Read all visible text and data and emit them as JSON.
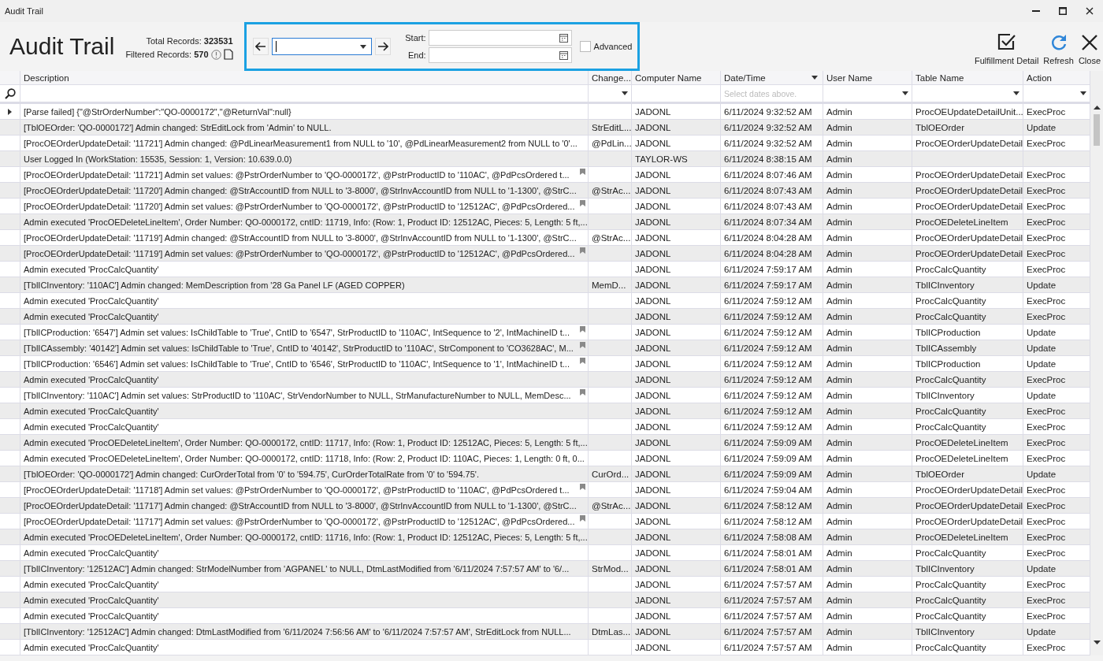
{
  "window": {
    "title": "Audit Trail"
  },
  "header": {
    "title": "Audit Trail",
    "total_label": "Total Records:",
    "total": "323531",
    "filtered_label": "Filtered Records:",
    "filtered": "570"
  },
  "filter": {
    "start_label": "Start:",
    "end_label": "End:",
    "advanced": {
      "label": "Advanced",
      "checked": false
    }
  },
  "toolbar": [
    {
      "label": "Fulfillment Detail",
      "kind": "check"
    },
    {
      "label": "Refresh",
      "kind": "refresh"
    },
    {
      "label": "Close",
      "kind": "close"
    }
  ],
  "table": {
    "columns": [
      {
        "label": "Description",
        "dropdown": false
      },
      {
        "label": "Change...",
        "dropdown": false
      },
      {
        "label": "Computer Name",
        "dropdown": false
      },
      {
        "label": "Date/Time",
        "dropdown": true
      },
      {
        "label": "User Name",
        "dropdown": false
      },
      {
        "label": "Table Name",
        "dropdown": false
      },
      {
        "label": "Action",
        "dropdown": false
      }
    ],
    "filter_row": [
      {
        "kind": "text"
      },
      {
        "kind": "dropdown"
      },
      {
        "kind": "text"
      },
      {
        "kind": "date",
        "placeholder": "Select dates above."
      },
      {
        "kind": "dropdown"
      },
      {
        "kind": "dropdown"
      },
      {
        "kind": "dropdown"
      }
    ],
    "rows": [
      {
        "current": true,
        "note": false,
        "cells": [
          "[Parse failed] {\"@StrOrderNumber\":\"QO-0000172\",\"@ReturnVal\":null}",
          "",
          "JADONL",
          "6/11/2024 9:32:52 AM",
          "Admin",
          "ProcOEUpdateDetailUnit...",
          "ExecProc"
        ]
      },
      {
        "current": false,
        "note": false,
        "cells": [
          "[TblOEOrder: 'QO-0000172'] Admin changed: StrEditLock from 'Admin' to NULL.",
          "StrEditL...",
          "JADONL",
          "6/11/2024 9:32:52 AM",
          "Admin",
          "TblOEOrder",
          "Update"
        ]
      },
      {
        "current": false,
        "note": false,
        "cells": [
          "[ProcOEOrderUpdateDetail: '11721'] Admin changed: @PdLinearMeasurement1 from NULL to '10', @PdLinearMeasurement2 from NULL to '0'...",
          "@PdLin...",
          "JADONL",
          "6/11/2024 9:32:52 AM",
          "Admin",
          "ProcOEOrderUpdateDetail",
          "ExecProc"
        ]
      },
      {
        "current": false,
        "note": false,
        "cells": [
          "User Logged In (WorkStation: 15535, Session: 1, Version: 10.639.0.0)",
          "",
          "TAYLOR-WS",
          "6/11/2024 8:38:15 AM",
          "Admin",
          "",
          ""
        ]
      },
      {
        "current": false,
        "note": true,
        "cells": [
          "[ProcOEOrderUpdateDetail: '11721'] Admin set values: @PstrOrderNumber to 'QO-0000172', @PstrProductID to '110AC', @PdPcsOrdered t...",
          "",
          "JADONL",
          "6/11/2024 8:07:46 AM",
          "Admin",
          "ProcOEOrderUpdateDetail",
          "ExecProc"
        ]
      },
      {
        "current": false,
        "note": false,
        "cells": [
          "[ProcOEOrderUpdateDetail: '11720'] Admin changed: @StrAccountID from NULL to '3-8000', @StrInvAccountID from NULL to '1-1300', @StrC...",
          "@StrAc...",
          "JADONL",
          "6/11/2024 8:07:43 AM",
          "Admin",
          "ProcOEOrderUpdateDetail",
          "ExecProc"
        ]
      },
      {
        "current": false,
        "note": true,
        "cells": [
          "[ProcOEOrderUpdateDetail: '11720'] Admin set values: @PstrOrderNumber to 'QO-0000172', @PstrProductID to '12512AC', @PdPcsOrdered...",
          "",
          "JADONL",
          "6/11/2024 8:07:43 AM",
          "Admin",
          "ProcOEOrderUpdateDetail",
          "ExecProc"
        ]
      },
      {
        "current": false,
        "note": false,
        "cells": [
          "Admin executed 'ProcOEDeleteLineItem', Order Number: QO-0000172, cntID: 11719, Info: (Row: 1, Product ID: 12512AC, Pieces: 5, Length: 5 ft,...",
          "",
          "JADONL",
          "6/11/2024 8:07:34 AM",
          "Admin",
          "ProcOEDeleteLineItem",
          "ExecProc"
        ]
      },
      {
        "current": false,
        "note": false,
        "cells": [
          "[ProcOEOrderUpdateDetail: '11719'] Admin changed: @StrAccountID from NULL to '3-8000', @StrInvAccountID from NULL to '1-1300', @StrC...",
          "@StrAc...",
          "JADONL",
          "6/11/2024 8:04:28 AM",
          "Admin",
          "ProcOEOrderUpdateDetail",
          "ExecProc"
        ]
      },
      {
        "current": false,
        "note": true,
        "cells": [
          "[ProcOEOrderUpdateDetail: '11719'] Admin set values: @PstrOrderNumber to 'QO-0000172', @PstrProductID to '12512AC', @PdPcsOrdered...",
          "",
          "JADONL",
          "6/11/2024 8:04:28 AM",
          "Admin",
          "ProcOEOrderUpdateDetail",
          "ExecProc"
        ]
      },
      {
        "current": false,
        "note": false,
        "cells": [
          "Admin executed 'ProcCalcQuantity'",
          "",
          "JADONL",
          "6/11/2024 7:59:17 AM",
          "Admin",
          "ProcCalcQuantity",
          "ExecProc"
        ]
      },
      {
        "current": false,
        "note": false,
        "cells": [
          "[TblICInventory: '110AC'] Admin changed: MemDescription from '28 Ga Panel LF (AGED COPPER)",
          "MemD...",
          "JADONL",
          "6/11/2024 7:59:17 AM",
          "Admin",
          "TblICInventory",
          "Update"
        ]
      },
      {
        "current": false,
        "note": false,
        "cells": [
          "Admin executed 'ProcCalcQuantity'",
          "",
          "JADONL",
          "6/11/2024 7:59:12 AM",
          "Admin",
          "ProcCalcQuantity",
          "ExecProc"
        ]
      },
      {
        "current": false,
        "note": false,
        "cells": [
          "Admin executed 'ProcCalcQuantity'",
          "",
          "JADONL",
          "6/11/2024 7:59:12 AM",
          "Admin",
          "ProcCalcQuantity",
          "ExecProc"
        ]
      },
      {
        "current": false,
        "note": true,
        "cells": [
          "[TblICProduction: '6547'] Admin set values: IsChildTable to 'True', CntID to '6547', StrProductID to '110AC', IntSequence to '2', IntMachineID t...",
          "",
          "JADONL",
          "6/11/2024 7:59:12 AM",
          "Admin",
          "TblICProduction",
          "Update"
        ]
      },
      {
        "current": false,
        "note": true,
        "cells": [
          "[TblICAssembly: '40142'] Admin set values: IsChildTable to 'True', CntID to '40142', StrProductID to '110AC', StrComponent to 'CO3628AC', M...",
          "",
          "JADONL",
          "6/11/2024 7:59:12 AM",
          "Admin",
          "TblICAssembly",
          "Update"
        ]
      },
      {
        "current": false,
        "note": true,
        "cells": [
          "[TblICProduction: '6546'] Admin set values: IsChildTable to 'True', CntID to '6546', StrProductID to '110AC', IntSequence to '1', IntMachineID t...",
          "",
          "JADONL",
          "6/11/2024 7:59:12 AM",
          "Admin",
          "TblICProduction",
          "Update"
        ]
      },
      {
        "current": false,
        "note": false,
        "cells": [
          "Admin executed 'ProcCalcQuantity'",
          "",
          "JADONL",
          "6/11/2024 7:59:12 AM",
          "Admin",
          "ProcCalcQuantity",
          "ExecProc"
        ]
      },
      {
        "current": false,
        "note": true,
        "cells": [
          "[TblICInventory: '110AC'] Admin set values: StrProductID to '110AC', StrVendorNumber to NULL, StrManufactureNumber to NULL, MemDesc...",
          "",
          "JADONL",
          "6/11/2024 7:59:12 AM",
          "Admin",
          "TblICInventory",
          "Update"
        ]
      },
      {
        "current": false,
        "note": false,
        "cells": [
          "Admin executed 'ProcCalcQuantity'",
          "",
          "JADONL",
          "6/11/2024 7:59:12 AM",
          "Admin",
          "ProcCalcQuantity",
          "ExecProc"
        ]
      },
      {
        "current": false,
        "note": false,
        "cells": [
          "Admin executed 'ProcCalcQuantity'",
          "",
          "JADONL",
          "6/11/2024 7:59:12 AM",
          "Admin",
          "ProcCalcQuantity",
          "ExecProc"
        ]
      },
      {
        "current": false,
        "note": false,
        "cells": [
          "Admin executed 'ProcOEDeleteLineItem', Order Number: QO-0000172, cntID: 11717, Info: (Row: 1, Product ID: 12512AC, Pieces: 5, Length: 5 ft,...",
          "",
          "JADONL",
          "6/11/2024 7:59:09 AM",
          "Admin",
          "ProcOEDeleteLineItem",
          "ExecProc"
        ]
      },
      {
        "current": false,
        "note": false,
        "cells": [
          "Admin executed 'ProcOEDeleteLineItem', Order Number: QO-0000172, cntID: 11718, Info: (Row: 2, Product ID: 110AC, Pieces: 1, Length: 0 ft, 0...",
          "",
          "JADONL",
          "6/11/2024 7:59:09 AM",
          "Admin",
          "ProcOEDeleteLineItem",
          "ExecProc"
        ]
      },
      {
        "current": false,
        "note": false,
        "cells": [
          "[TblOEOrder: 'QO-0000172'] Admin changed: CurOrderTotal from '0' to '594.75', CurOrderTotalRate from '0' to '594.75'.",
          "CurOrd...",
          "JADONL",
          "6/11/2024 7:59:09 AM",
          "Admin",
          "TblOEOrder",
          "Update"
        ]
      },
      {
        "current": false,
        "note": true,
        "cells": [
          "[ProcOEOrderUpdateDetail: '11718'] Admin set values: @PstrOrderNumber to 'QO-0000172', @PstrProductID to '110AC', @PdPcsOrdered t...",
          "",
          "JADONL",
          "6/11/2024 7:59:04 AM",
          "Admin",
          "ProcOEOrderUpdateDetail",
          "ExecProc"
        ]
      },
      {
        "current": false,
        "note": false,
        "cells": [
          "[ProcOEOrderUpdateDetail: '11717'] Admin changed: @StrAccountID from NULL to '3-8000', @StrInvAccountID from NULL to '1-1300', @StrC...",
          "@StrAc...",
          "JADONL",
          "6/11/2024 7:58:12 AM",
          "Admin",
          "ProcOEOrderUpdateDetail",
          "ExecProc"
        ]
      },
      {
        "current": false,
        "note": true,
        "cells": [
          "[ProcOEOrderUpdateDetail: '11717'] Admin set values: @PstrOrderNumber to 'QO-0000172', @PstrProductID to '12512AC', @PdPcsOrdered...",
          "",
          "JADONL",
          "6/11/2024 7:58:12 AM",
          "Admin",
          "ProcOEOrderUpdateDetail",
          "ExecProc"
        ]
      },
      {
        "current": false,
        "note": false,
        "cells": [
          "Admin executed 'ProcOEDeleteLineItem', Order Number: QO-0000172, cntID: 11716, Info: (Row: 1, Product ID: 12512AC, Pieces: 5, Length: 5 ft,...",
          "",
          "JADONL",
          "6/11/2024 7:58:08 AM",
          "Admin",
          "ProcOEDeleteLineItem",
          "ExecProc"
        ]
      },
      {
        "current": false,
        "note": false,
        "cells": [
          "Admin executed 'ProcCalcQuantity'",
          "",
          "JADONL",
          "6/11/2024 7:58:01 AM",
          "Admin",
          "ProcCalcQuantity",
          "ExecProc"
        ]
      },
      {
        "current": false,
        "note": false,
        "cells": [
          "[TblICInventory: '12512AC'] Admin changed: StrModelNumber from 'AGPANEL' to NULL, DtmLastModified from '6/11/2024 7:57:57 AM' to '6/...",
          "StrMod...",
          "JADONL",
          "6/11/2024 7:58:01 AM",
          "Admin",
          "TblICInventory",
          "Update"
        ]
      },
      {
        "current": false,
        "note": false,
        "cells": [
          "Admin executed 'ProcCalcQuantity'",
          "",
          "JADONL",
          "6/11/2024 7:57:57 AM",
          "Admin",
          "ProcCalcQuantity",
          "ExecProc"
        ]
      },
      {
        "current": false,
        "note": false,
        "cells": [
          "Admin executed 'ProcCalcQuantity'",
          "",
          "JADONL",
          "6/11/2024 7:57:57 AM",
          "Admin",
          "ProcCalcQuantity",
          "ExecProc"
        ]
      },
      {
        "current": false,
        "note": false,
        "cells": [
          "Admin executed 'ProcCalcQuantity'",
          "",
          "JADONL",
          "6/11/2024 7:57:57 AM",
          "Admin",
          "ProcCalcQuantity",
          "ExecProc"
        ]
      },
      {
        "current": false,
        "note": false,
        "cells": [
          "[TblICInventory: '12512AC'] Admin changed: DtmLastModified from '6/11/2024 7:56:56 AM' to '6/11/2024 7:57:57 AM', StrEditLock from NULL...",
          "DtmLas...",
          "JADONL",
          "6/11/2024 7:57:57 AM",
          "Admin",
          "TblICInventory",
          "Update"
        ]
      },
      {
        "current": false,
        "note": false,
        "cells": [
          "Admin executed 'ProcCalcQuantity'",
          "",
          "JADONL",
          "6/11/2024 7:57:57 AM",
          "Admin",
          "ProcCalcQuantity",
          "ExecProc"
        ]
      }
    ]
  }
}
